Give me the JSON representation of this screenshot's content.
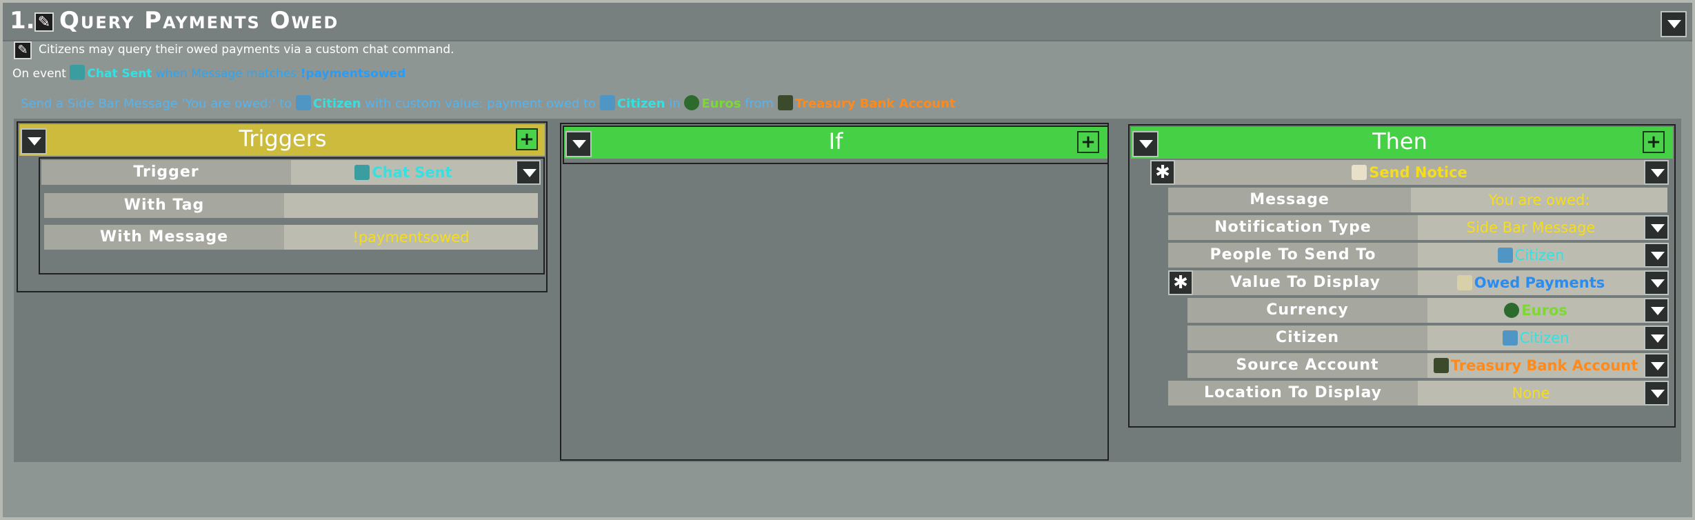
{
  "header": {
    "number": "1.",
    "title": "Query Payments Owed",
    "description": "Citizens may query their owed payments via a custom chat command."
  },
  "event_line": {
    "prefix": "On event",
    "event": "Chat Sent",
    "middle": "when Message matches",
    "match": "!paymentsowed"
  },
  "summary": {
    "p1": "Send a Side Bar Message 'You are owed:' to",
    "citizen": "Citizen",
    "p2": "with custom value: payment owed to",
    "citizen2": "Citizen",
    "p3": "in",
    "euros": "Euros",
    "p4": "from",
    "account": "Treasury Bank Account"
  },
  "triggers": {
    "title": "Triggers",
    "rows": [
      {
        "label": "Trigger",
        "value": "Chat Sent"
      },
      {
        "label": "With Tag",
        "value": ""
      },
      {
        "label": "With Message",
        "value": "!paymentsowed"
      }
    ]
  },
  "if_panel": {
    "title": "If"
  },
  "then_panel": {
    "title": "Then",
    "action": "Send Notice",
    "rows": {
      "message": {
        "label": "Message",
        "value": "You are owed:"
      },
      "notification_type": {
        "label": "Notification Type",
        "value": "Side Bar Message"
      },
      "people": {
        "label": "People To Send To",
        "value": "Citizen"
      },
      "value_display": {
        "label": "Value To Display",
        "value": "Owed Payments"
      },
      "currency": {
        "label": "Currency",
        "value": "Euros"
      },
      "citizen": {
        "label": "Citizen",
        "value": "Citizen"
      },
      "source": {
        "label": "Source Account",
        "value": "Treasury Bank Account"
      },
      "location": {
        "label": "Location To Display",
        "value": "None"
      }
    }
  },
  "colors": {
    "triggers_header": "#cdbb3d",
    "if_then_header": "#45d045",
    "cyan": "#36e0e0",
    "green": "#7dd836",
    "orange": "#ff8a1a",
    "yellow": "#f4dd1f",
    "blue": "#2a8cf0"
  }
}
